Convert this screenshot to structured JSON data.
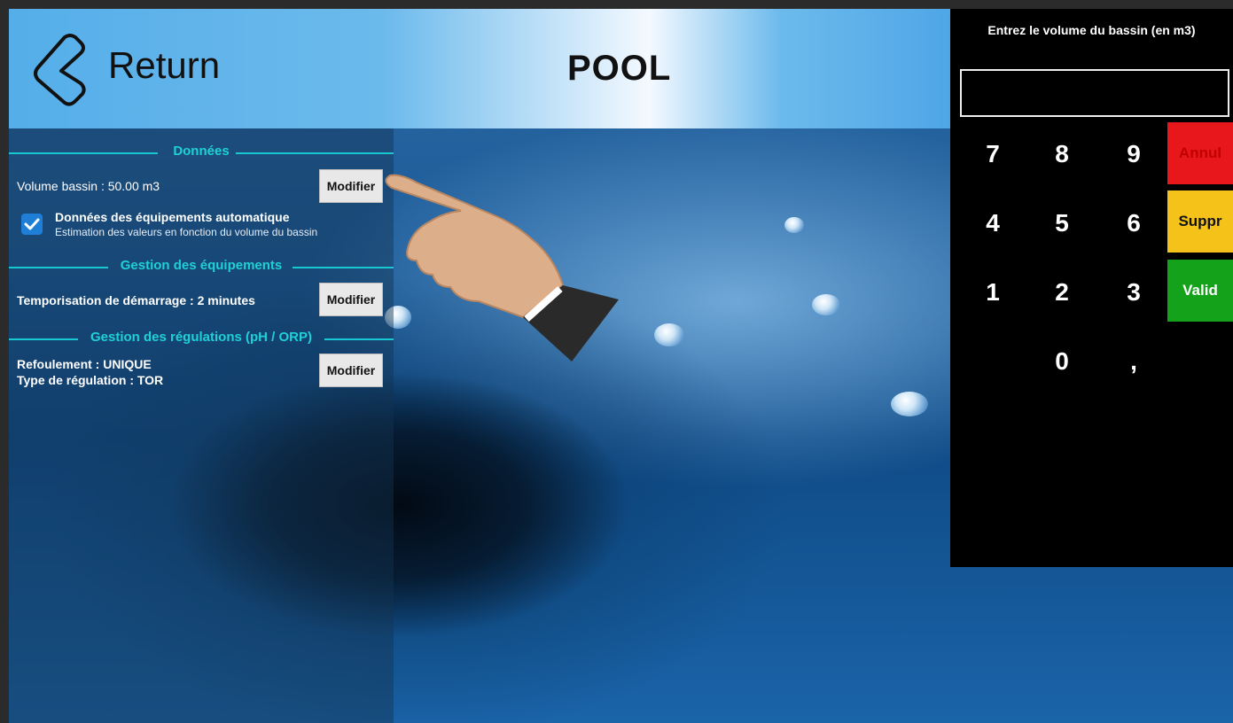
{
  "header": {
    "return_label": "Return",
    "title": "POOL"
  },
  "panel": {
    "section_data": "Données",
    "volume_label": "Volume bassin : 50.00 m3",
    "volume_button": "Modifier",
    "auto_checkbox_checked": true,
    "auto_title": "Données des équipements automatique",
    "auto_subtitle": "Estimation des valeurs en fonction du volume du bassin",
    "section_equipment": "Gestion des équipements",
    "startup_delay_label": "Temporisation de démarrage : 2 minutes",
    "startup_button": "Modifier",
    "section_regulation": "Gestion des régulations (pH / ORP)",
    "discharge_label": "Refoulement : UNIQUE",
    "regulation_type_label": "Type de régulation : TOR",
    "regulation_button": "Modifier"
  },
  "keypad": {
    "title": "Entrez le volume du bassin (en m3)",
    "input_value": "",
    "keys": [
      "7",
      "8",
      "9",
      "4",
      "5",
      "6",
      "1",
      "2",
      "3",
      "0",
      ","
    ],
    "cancel_label": "Annul",
    "delete_label": "Suppr",
    "validate_label": "Valid",
    "colors": {
      "cancel": "#e8171b",
      "delete": "#f5c21a",
      "validate": "#13a21a"
    }
  },
  "icons": {
    "back": "chevron-left-icon",
    "checkbox": "checkmark-icon",
    "pointer": "pointing-hand-icon"
  }
}
